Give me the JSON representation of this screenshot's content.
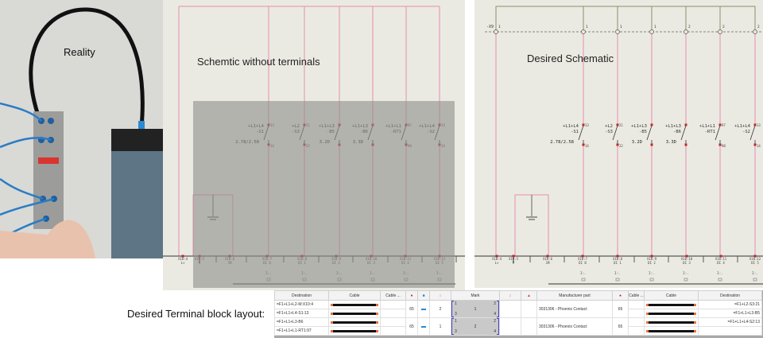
{
  "photo": {
    "caption": "Reality"
  },
  "middle": {
    "caption": "Schemtic without terminals"
  },
  "right": {
    "caption": "Desired Schematic",
    "strip_tag": "-X9",
    "strip_numbers": [
      "1",
      "1",
      "1",
      "1",
      "2",
      "2",
      "2"
    ]
  },
  "components": [
    {
      "loc": "+L1+L4",
      "tag": "-S1",
      "value": "2.78/2.58",
      "top": "13",
      "bottom": "14"
    },
    {
      "loc": "+L2",
      "tag": "-S3",
      "value": "",
      "top": "21",
      "bottom": "22"
    },
    {
      "loc": "+L1+L3",
      "tag": "-B5",
      "value": "3.2D",
      "top": "",
      "bottom": ""
    },
    {
      "loc": "+L1+L3",
      "tag": "-B6",
      "value": "3.3D",
      "top": "",
      "bottom": ""
    },
    {
      "loc": "+L1+L1",
      "tag": "-RT1",
      "value": "",
      "top": "97",
      "bottom": "98"
    },
    {
      "loc": "+L1+L4",
      "tag": "-S2",
      "value": "",
      "top": "13",
      "bottom": "14"
    }
  ],
  "terminals": [
    {
      "id": "X10:4",
      "label": "L+"
    },
    {
      "id": "X10:5",
      "label": "M"
    },
    {
      "id": "X10:6",
      "label": "1M"
    },
    {
      "id": "X10:7",
      "label": "DI 0"
    },
    {
      "id": "X10:8",
      "label": "DI 1"
    },
    {
      "id": "X10:9",
      "label": "DI 2"
    },
    {
      "id": "X10:10",
      "label": "DI 3"
    },
    {
      "id": "X10:11",
      "label": "DI 4"
    },
    {
      "id": "X10:12",
      "label": "DI 5"
    }
  ],
  "io_ref": "I:.",
  "terminal_block": {
    "title": "Desired Terminal block layout:",
    "headers": {
      "destination": "Destination",
      "cable": "Cable",
      "cable_short": "Cable ...",
      "mark": "Mark",
      "manufacturer_part": "Manufacturer part"
    },
    "groups": [
      {
        "left": [
          "=F1+L1+L2-M:X10:4",
          "=F1+L1+L4-S1:13"
        ],
        "value": "65",
        "level": "2",
        "mark": "1",
        "corners": [
          "1",
          "2",
          "3",
          "4"
        ],
        "part": "3031306 - Phoenix Contact",
        "part_value": "65",
        "right": [
          "=F1+L2-S3:21",
          "=F1+L1+L3-B5"
        ]
      },
      {
        "left": [
          "=F1+L1+L3-B6",
          "=F1+L1+L1-RT1:97"
        ],
        "value": "65",
        "level": "1",
        "mark": "2",
        "corners": [
          "1",
          "2",
          "3",
          "4"
        ],
        "part": "3031306 - Phoenix Contact",
        "part_value": "65",
        "right": [
          "=F1+L1+L4-S2:13",
          ""
        ]
      }
    ]
  },
  "colors": {
    "wire": "#e58fb0",
    "pin": "#c0262c",
    "strip": "#8c8f6a",
    "overlay": "#8d8e8a"
  }
}
